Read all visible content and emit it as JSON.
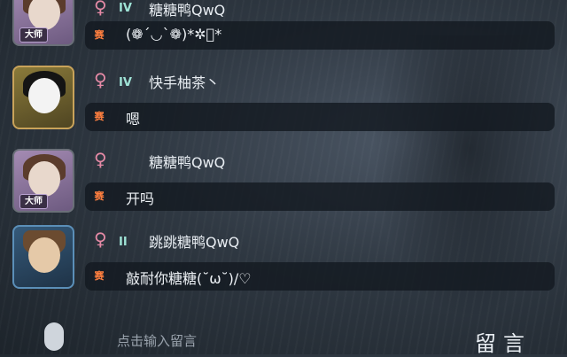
{
  "chat": {
    "messages": [
      {
        "rank_badge": "大师",
        "gender": "♀",
        "tier": "IV",
        "name": "糖糖鸭QwQ",
        "tag": "赛",
        "text": "(❁´◡`❁)*✲ﾟ*"
      },
      {
        "rank_badge": "",
        "gender": "♀",
        "tier": "IV",
        "name": "快手柚茶丶",
        "tag": "赛",
        "text": "嗯"
      },
      {
        "rank_badge": "大师",
        "gender": "♀",
        "tier": "",
        "name": "糖糖鸭QwQ",
        "tag": "赛",
        "text": "开吗"
      },
      {
        "rank_badge": "",
        "gender": "♀",
        "tier": "II",
        "name": "跳跳糖鸭QwQ",
        "tag": "赛",
        "text": "敲耐你糖糖(˘ω˘)/♡"
      }
    ]
  },
  "bottom": {
    "input_placeholder": "点击输入留言",
    "send_label": "留言"
  },
  "icons": {
    "gender": "female-icon",
    "tier": "antler-icon",
    "mic": "microphone-icon"
  },
  "colors": {
    "gender": "#e58aa6",
    "tag": "#ff7f3f",
    "name": "#e8edf2"
  }
}
